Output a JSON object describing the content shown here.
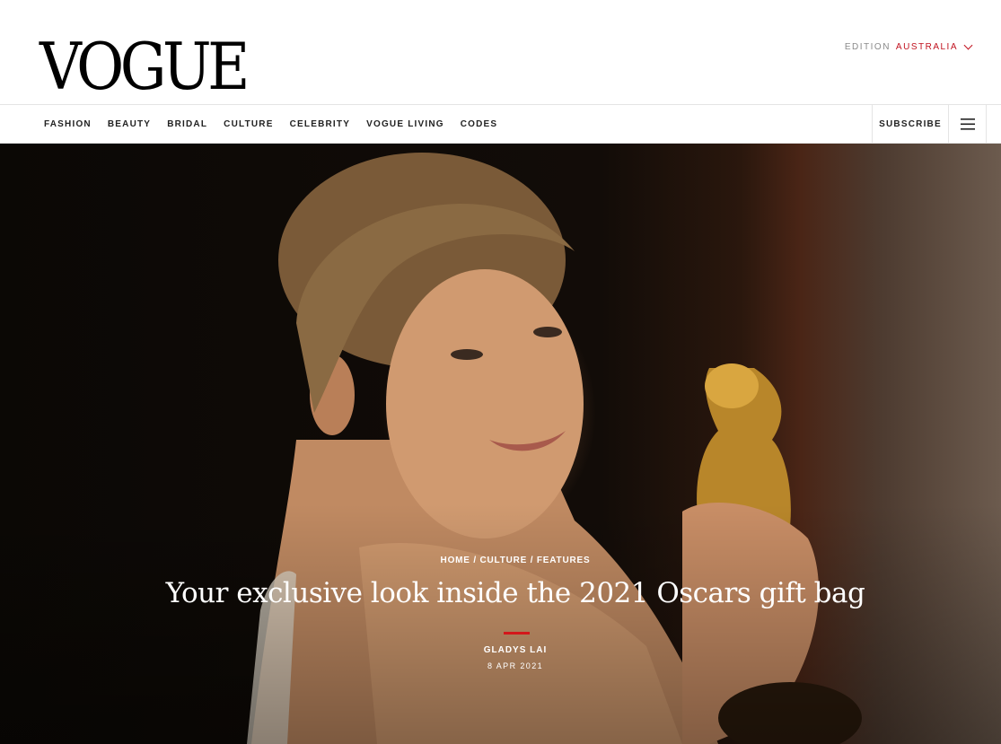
{
  "header": {
    "logo_text": "VOGUE",
    "edition_label": "EDITION",
    "edition_value": "AUSTRALIA"
  },
  "nav": {
    "items": [
      {
        "label": "FASHION"
      },
      {
        "label": "BEAUTY"
      },
      {
        "label": "BRIDAL"
      },
      {
        "label": "CULTURE"
      },
      {
        "label": "CELEBRITY"
      },
      {
        "label": "VOGUE LIVING"
      },
      {
        "label": "CODES"
      }
    ],
    "subscribe_label": "SUBSCRIBE",
    "menu_icon": "hamburger-menu-icon"
  },
  "article": {
    "breadcrumb": [
      "HOME",
      "CULTURE",
      "FEATURES"
    ],
    "breadcrumb_separator": " / ",
    "headline": "Your exclusive look inside the 2021 Oscars gift bag",
    "author": "GLADYS LAI",
    "date": "8 APR 2021"
  },
  "colors": {
    "accent": "#c1121f",
    "rule": "#d3171b",
    "text": "#111111",
    "nav_border": "#e4e4e4"
  }
}
